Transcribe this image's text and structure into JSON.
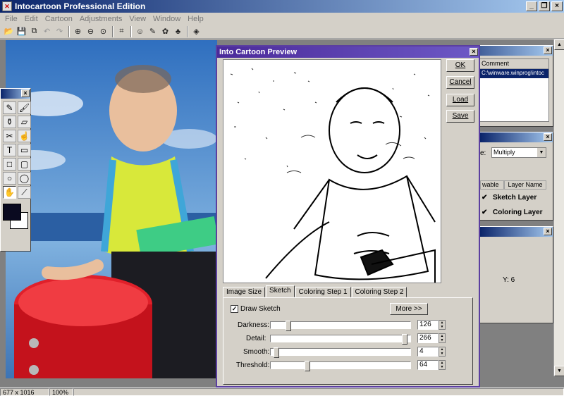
{
  "app": {
    "title": "Intocartoon Professional Edition",
    "icon": "app-logo-icon"
  },
  "menu": [
    "File",
    "Edit",
    "Cartoon",
    "Adjustments",
    "View",
    "Window",
    "Help"
  ],
  "toolbar": {
    "icons": [
      "open-icon",
      "save-icon",
      "copy-icon",
      "undo-icon",
      "redo-icon",
      "zoom-in-icon",
      "zoom-out-icon",
      "zoom-fit-icon",
      "crop-icon",
      "cartoon-icon",
      "sketch-icon",
      "color-icon",
      "paint-icon",
      "eraser-icon"
    ]
  },
  "tools_panel": {
    "tools": [
      "pencil-icon",
      "brush-icon",
      "bucket-icon",
      "eraser-icon",
      "dropper-icon",
      "smudge-icon",
      "text-icon",
      "callout-icon",
      "rectangle-icon",
      "rounded-rect-icon",
      "ellipse-icon",
      "speech-bubble-icon",
      "hand-icon",
      "eyedropper-icon"
    ],
    "foreground_color": "#0a0a20",
    "background_color": "#ffffff"
  },
  "history_panel": {
    "header_comment": "Comment",
    "row_comment": "C:\\winware.winprog\\intoc"
  },
  "layers_panel": {
    "mode_label": "e:",
    "mode_value": "Multiply",
    "col_visible": "wable",
    "col_name": "Layer Name",
    "layers": [
      {
        "name": "Sketch Layer",
        "checked": true
      },
      {
        "name": "Coloring Layer",
        "checked": true
      }
    ]
  },
  "info_panel": {
    "y_value": "Y: 6"
  },
  "dialog": {
    "title": "Into Cartoon Preview",
    "buttons": {
      "ok": "OK",
      "cancel": "Cancel",
      "load": "Load",
      "save": "Save"
    },
    "tabs": [
      "Image Size",
      "Sketch",
      "Coloring Step 1",
      "Coloring Step 2"
    ],
    "active_tab": "Sketch",
    "draw_sketch_label": "Draw Sketch",
    "draw_sketch_checked": true,
    "more_button": "More >>",
    "sliders": [
      {
        "label": "Darkness:",
        "value": "126",
        "fraction": 0.11
      },
      {
        "label": "Detail:",
        "value": "266",
        "fraction": 0.98
      },
      {
        "label": "Smooth:",
        "value": "4",
        "fraction": 0.02
      },
      {
        "label": "Threshold:",
        "value": "64",
        "fraction": 0.25
      }
    ]
  },
  "status": {
    "dimensions": "677 x 1016",
    "zoom": "100%"
  }
}
